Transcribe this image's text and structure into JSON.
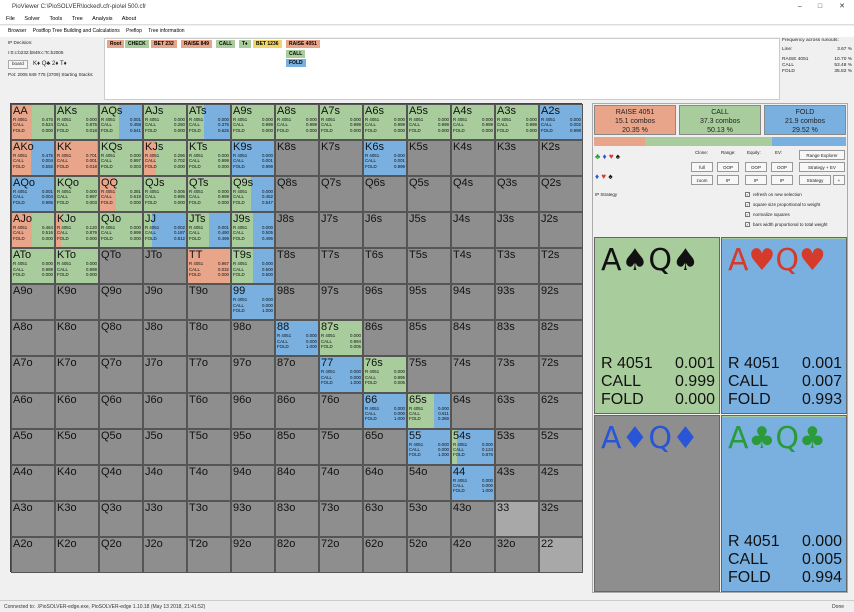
{
  "window": {
    "title": "PioViewer C:\\PioSOLVER\\locked\\.cfr-pio\\el 500.cfr"
  },
  "menu": [
    "File",
    "Solver",
    "Tools",
    "Tree",
    "Analysis",
    "About"
  ],
  "tabs": [
    "Browser",
    "Postflop Tree Building and Calculations",
    "Preflop",
    "Tree information"
  ],
  "decision": {
    "label": "IP Decision:",
    "line": "r:0:c:b232:b849:c:Tc:b2005",
    "board_btn": "board",
    "cards": "K♦  Q♣  2♦  T♦",
    "pot": "Pot: 2005 849 775 (3709) Starting Stacks:"
  },
  "actions": {
    "root": "Root",
    "check": "CHECK",
    "bet232": "BET 232",
    "raise849": "RAISE 849",
    "call": "CALL",
    "t": "T♦",
    "bet1236": "BET 1236",
    "raise4051": "RAISE 4051",
    "call2": "CALL",
    "fold": "FOLD"
  },
  "freq": {
    "title": "Frequency across runouts:",
    "line_label": "Line:",
    "line_val": "3.67 %",
    "rows": [
      {
        "k": "RAISE 4051",
        "v": "10.70 %"
      },
      {
        "k": "CALL",
        "v": "53.48 %"
      },
      {
        "k": "FOLD",
        "v": "35.82 %"
      }
    ]
  },
  "summary": [
    {
      "name": "RAISE 4051",
      "combos": "15.1 combos",
      "pct": "20.35 %",
      "color": "#e8a58a"
    },
    {
      "name": "CALL",
      "combos": "37.3 combos",
      "pct": "50.13 %",
      "color": "#a8cc9c"
    },
    {
      "name": "FOLD",
      "combos": "21.9 combos",
      "pct": "29.52 %",
      "color": "#79b0e0"
    }
  ],
  "summary_bar": [
    0.2035,
    0.5013,
    0.2952
  ],
  "controls": {
    "clone": "Clone:",
    "range": "Range:",
    "equity": "Equity:",
    "ev": "EV:",
    "range_explorer": "Range Explorer",
    "strategy_ev": "Strategy + EV",
    "strategy": "Strategy",
    "plus": "+",
    "full": "full",
    "zoom": "zoom",
    "oop": "OOP",
    "ip": "IP",
    "ip_strategy": "IP Strategy"
  },
  "checks": [
    "refresh on new selection",
    "square size proportional to weight",
    "normalize squares",
    "bars width proportional to total weight"
  ],
  "combos": [
    {
      "cards": "A♠Q♠",
      "color": "#111",
      "bg": [
        [
          0.001,
          "#e8a58a"
        ],
        [
          0.999,
          "#a8cc9c"
        ],
        [
          0,
          "#79b0e0"
        ]
      ],
      "r": "0.001",
      "c": "0.999",
      "f": "0.000"
    },
    {
      "cards": "A♥Q♥",
      "color": "#d63a2a",
      "bg": [
        [
          0.001,
          "#e8a58a"
        ],
        [
          0.007,
          "#a8cc9c"
        ],
        [
          0.993,
          "#79b0e0"
        ]
      ],
      "r": "0.001",
      "c": "0.007",
      "f": "0.993"
    },
    {
      "cards": "A♦Q♦",
      "color": "#2a55d6",
      "bg": [
        [
          0,
          "#e8a58a"
        ],
        [
          0,
          "#a8cc9c"
        ],
        [
          0,
          "#79b0e0"
        ],
        [
          1,
          "#8e8e8e"
        ]
      ],
      "r": "",
      "c": "",
      "f": ""
    },
    {
      "cards": "A♣Q♣",
      "color": "#2a9a3a",
      "bg": [
        [
          0,
          "#e8a58a"
        ],
        [
          0.005,
          "#a8cc9c"
        ],
        [
          0.994,
          "#79b0e0"
        ]
      ],
      "r": "0.000",
      "c": "0.005",
      "f": "0.994"
    }
  ],
  "combo_labels": {
    "r": "R 4051",
    "c": "CALL",
    "f": "FOLD"
  },
  "status": {
    "left": "Connected to: .\\PioSOLVER-edge.exe, PioSOLVER-edge 1.10.18 (May 13 2018, 21:41:52)",
    "right": "Done"
  },
  "grid": [
    [
      "AA",
      "AKs",
      "AQs",
      "AJs",
      "ATs",
      "A9s",
      "A8s",
      "A7s",
      "A6s",
      "A5s",
      "A4s",
      "A3s",
      "A2s"
    ],
    [
      "AKo",
      "KK",
      "KQs",
      "KJs",
      "KTs",
      "K9s",
      "K8s",
      "K7s",
      "K6s",
      "K5s",
      "K4s",
      "K3s",
      "K2s"
    ],
    [
      "AQo",
      "KQo",
      "QQ",
      "QJs",
      "QTs",
      "Q9s",
      "Q8s",
      "Q7s",
      "Q6s",
      "Q5s",
      "Q4s",
      "Q3s",
      "Q2s"
    ],
    [
      "AJo",
      "KJo",
      "QJo",
      "JJ",
      "JTs",
      "J9s",
      "J8s",
      "J7s",
      "J6s",
      "J5s",
      "J4s",
      "J3s",
      "J2s"
    ],
    [
      "ATo",
      "KTo",
      "QTo",
      "JTo",
      "TT",
      "T9s",
      "T8s",
      "T7s",
      "T6s",
      "T5s",
      "T4s",
      "T3s",
      "T2s"
    ],
    [
      "A9o",
      "K9o",
      "Q9o",
      "J9o",
      "T9o",
      "99",
      "98s",
      "97s",
      "96s",
      "95s",
      "94s",
      "93s",
      "92s"
    ],
    [
      "A8o",
      "K8o",
      "Q8o",
      "J8o",
      "T8o",
      "98o",
      "88",
      "87s",
      "86s",
      "85s",
      "84s",
      "83s",
      "82s"
    ],
    [
      "A7o",
      "K7o",
      "Q7o",
      "J7o",
      "T7o",
      "97o",
      "87o",
      "77",
      "76s",
      "75s",
      "74s",
      "73s",
      "72s"
    ],
    [
      "A6o",
      "K6o",
      "Q6o",
      "J6o",
      "T6o",
      "96o",
      "86o",
      "76o",
      "66",
      "65s",
      "64s",
      "63s",
      "62s"
    ],
    [
      "A5o",
      "K5o",
      "Q5o",
      "J5o",
      "T5o",
      "95o",
      "85o",
      "75o",
      "65o",
      "55",
      "54s",
      "53s",
      "52s"
    ],
    [
      "A4o",
      "K4o",
      "Q4o",
      "J4o",
      "T4o",
      "94o",
      "84o",
      "74o",
      "64o",
      "54o",
      "44",
      "43s",
      "42s"
    ],
    [
      "A3o",
      "K3o",
      "Q3o",
      "J3o",
      "T3o",
      "93o",
      "83o",
      "73o",
      "63o",
      "53o",
      "43o",
      "33",
      "32s"
    ],
    [
      "A2o",
      "K2o",
      "Q2o",
      "J2o",
      "T2o",
      "92o",
      "82o",
      "72o",
      "62o",
      "52o",
      "42o",
      "32o",
      "22"
    ]
  ],
  "stats": {
    "AA": [
      0.475,
      0.524,
      0.0
    ],
    "AKs": [
      0.0,
      0.875,
      0.018
    ],
    "AQs": [
      0.001,
      0.458,
      0.541
    ],
    "AJs": [
      0.0,
      0.25,
      0.0
    ],
    "ATs": [
      0.0,
      0.375,
      0.625
    ],
    "A9s": [
      0.0,
      0.999,
      0.0
    ],
    "A8s": [
      0.0,
      0.999,
      0.0
    ],
    "A7s": [
      0.0,
      0.999,
      0.0
    ],
    "A6s": [
      0.0,
      0.999,
      0.0
    ],
    "A5s": [
      0.0,
      0.999,
      0.0
    ],
    "A4s": [
      0.0,
      0.999,
      0.0
    ],
    "A3s": [
      0.0,
      0.999,
      0.0
    ],
    "A2s": [
      0.0,
      0.002,
      0.998
    ],
    "AKo": [
      0.475,
      0.004,
      0.592
    ],
    "KK": [
      0.701,
      0.001,
      0.018
    ],
    "KQs": [
      0.0,
      0.997,
      0.003
    ],
    "KJs": [
      0.296,
      0.702,
      0.0
    ],
    "KTs": [
      0.0,
      0.999,
      0.0
    ],
    "K9s": [
      0.0,
      0.001,
      0.999
    ],
    "K6s": [
      0.0,
      0.001,
      0.999
    ],
    "AQo": [
      0.001,
      0.004,
      0.995
    ],
    "KQo": [
      0.0,
      0.997,
      0.003
    ],
    "QQ": [
      0.381,
      0.619,
      0.0
    ],
    "QJs": [
      0.005,
      0.995,
      0.0
    ],
    "QTs": [
      0.0,
      0.999,
      0.0
    ],
    "Q9s": [
      0.0,
      0.452,
      0.547
    ],
    "AJo": [
      0.464,
      0.516,
      0.0
    ],
    "KJo": [
      0.12,
      0.879,
      0.0
    ],
    "QJo": [
      0.0,
      0.999,
      0.0
    ],
    "JJ": [
      0.002,
      0.187,
      0.812
    ],
    "JTs": [
      0.001,
      0.49,
      0.499
    ],
    "J9s": [
      0.0,
      0.505,
      0.495
    ],
    "ATo": [
      0.0,
      0.999,
      0.0
    ],
    "KTo": [
      0.0,
      0.999,
      0.0
    ],
    "TT": [
      0.967,
      0.032,
      0.0
    ],
    "T9s": [
      0.0,
      0.5,
      0.5
    ],
    "99": [
      0.0,
      0.0,
      1.0
    ],
    "88": [
      0.0,
      0.0,
      1.0
    ],
    "87s": [
      0.0,
      0.994,
      0.005
    ],
    "77": [
      0.0,
      0.0,
      1.0
    ],
    "76s": [
      0.0,
      0.995,
      0.005
    ],
    "66": [
      0.0,
      0.0,
      1.0
    ],
    "65s": [
      0.0,
      0.611,
      0.388
    ],
    "55": [
      0.0,
      0.0,
      1.0
    ],
    "54s": [
      0.0,
      0.124,
      0.876
    ],
    "44": [
      0.0,
      0.0,
      1.0
    ]
  },
  "stat_keys": [
    "R 4051",
    "CALL",
    "FOLD"
  ],
  "colors": {
    "raise": "#e8a58a",
    "call": "#a8cc9c",
    "fold": "#79b0e0",
    "empty": "#8e8e8e",
    "dim": "#a8a8a8"
  }
}
